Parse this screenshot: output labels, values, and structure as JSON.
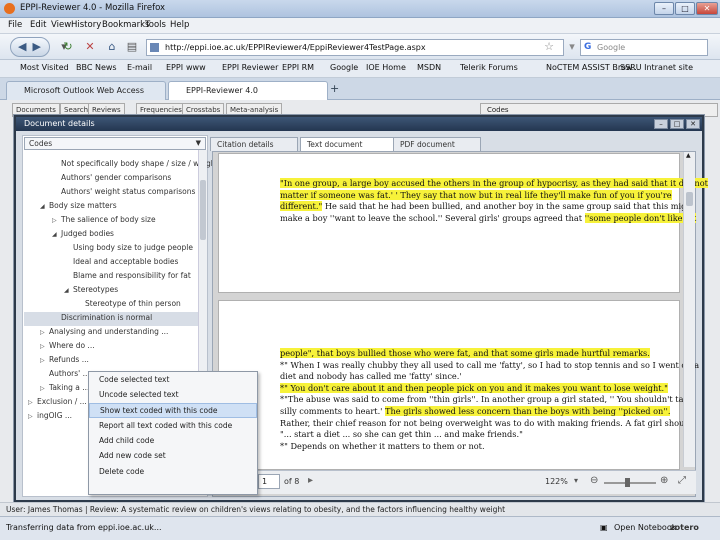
{
  "window": {
    "title": "EPPI-Reviewer 4.0 - Mozilla Firefox"
  },
  "menu": [
    "File",
    "Edit",
    "View",
    "History",
    "Bookmarks",
    "Tools",
    "Help"
  ],
  "nav": {
    "url": "http://eppi.ioe.ac.uk/EPPIReviewer4/EppiReviewer4TestPage.aspx",
    "search_placeholder": "Google"
  },
  "bookmarks": [
    "Most Visited",
    "BBC News",
    "E-mail",
    "EPPI",
    "www",
    "EPPI Reviewer",
    "EPPI RM",
    "Google",
    "IOE Home",
    "MSDN",
    "Telerik Forums",
    "NoCTEM ASSIST Brow...",
    "SSRU Intranet site"
  ],
  "browser_tabs": [
    "Microsoft Outlook Web Access",
    "EPPI-Reviewer 4.0"
  ],
  "app_tabs": [
    "Documents",
    "Search",
    "Reviews",
    "Frequencies",
    "Crosstabs",
    "Meta-analysis"
  ],
  "right_header": "Codes",
  "dialog": {
    "title": "Document details"
  },
  "code_select": "Codes",
  "tree": [
    {
      "label": "Not specifically body shape / size / weight",
      "indent": 2,
      "toggle": ""
    },
    {
      "label": "Authors' gender comparisons",
      "indent": 2,
      "toggle": ""
    },
    {
      "label": "Authors' weight status comparisons",
      "indent": 2,
      "toggle": ""
    },
    {
      "label": "Body size matters",
      "indent": 1,
      "toggle": "◢"
    },
    {
      "label": "The salience of body size",
      "indent": 2,
      "toggle": "▷"
    },
    {
      "label": "Judged bodies",
      "indent": 2,
      "toggle": "◢"
    },
    {
      "label": "Using body size to judge people",
      "indent": 3,
      "toggle": ""
    },
    {
      "label": "Ideal and acceptable bodies",
      "indent": 3,
      "toggle": ""
    },
    {
      "label": "Blame and responsibility for fat",
      "indent": 3,
      "toggle": ""
    },
    {
      "label": "Stereotypes",
      "indent": 3,
      "toggle": "◢"
    },
    {
      "label": "Stereotype of thin person",
      "indent": 4,
      "toggle": ""
    },
    {
      "label": "Discrimination is normal",
      "indent": 2,
      "toggle": "",
      "selected": true
    },
    {
      "label": "Analysing and understanding ...",
      "indent": 1,
      "toggle": "▷"
    },
    {
      "label": "Where do ...",
      "indent": 1,
      "toggle": "▷"
    },
    {
      "label": "Refunds ...",
      "indent": 1,
      "toggle": "▷"
    },
    {
      "label": "Authors' ...",
      "indent": 1,
      "toggle": ""
    },
    {
      "label": "Taking a ...",
      "indent": 1,
      "toggle": "▷"
    },
    {
      "label": "Exclusion / ...",
      "indent": 0,
      "toggle": "▷"
    },
    {
      "label": "ingOIG ...",
      "indent": 0,
      "toggle": "▷"
    }
  ],
  "doc_tabs": [
    "Citation details",
    "Text document",
    "PDF document"
  ],
  "page1": [
    [
      {
        "t": "\"In one group, a large boy accused the others in the group of hypocrisy, as they had said that it did not",
        "h": true
      }
    ],
    [
      {
        "t": "matter if someone was fat.' ' They say that now but in real life they'll make fun of you if you're",
        "h": true
      }
    ],
    [
      {
        "t": "different.\"",
        "h": true
      },
      {
        "t": " He said that he had been bullied, and another boy in the same group said that this might",
        "h": false
      }
    ],
    [
      {
        "t": "make a boy ''want to leave the school.'' Several girls' groups agreed that ",
        "h": false
      },
      {
        "t": "''some people don't like fat",
        "h": true
      }
    ]
  ],
  "page2": [
    [
      {
        "t": "people\", that boys bullied those who were fat, and that some girls made hurtful remarks.",
        "h": true
      }
    ],
    [
      {
        "t": "*\" When I was really chubby they all used to call me 'fatty', so I had to stop tennis and so I went on a",
        "h": false
      }
    ],
    [
      {
        "t": "diet and nobody has called me 'fatty' since.'",
        "h": false
      }
    ],
    [
      {
        "t": "*\" You don't care about it and then people pick on you and it makes you want to lose weight.\"",
        "h": true
      }
    ],
    [
      {
        "t": "*\"The abuse was said to come from ''thin girls''. In another group a girl stated, '' You shouldn't take",
        "h": false
      }
    ],
    [
      {
        "t": "silly comments to heart.' ",
        "h": false
      },
      {
        "t": "The girls showed less concern than the boys with being ''picked on''.",
        "h": true
      }
    ],
    [
      {
        "t": "Rather, their chief reason for not being overweight was to do with making friends. A fat girl should:",
        "h": false
      }
    ],
    [
      {
        "t": "\"... start a diet ... so she can get thin ... and make friends.\"",
        "h": false
      }
    ],
    [
      {
        "t": "*\" Depends on whether it matters to them or not.",
        "h": false
      }
    ]
  ],
  "pdf": {
    "page": "1",
    "of": "of 8",
    "zoom": "122%"
  },
  "context_menu": [
    "Code selected text",
    "Uncode selected text",
    "Show text coded with this code",
    "Report all text coded with this code",
    "Add child code",
    "Add new code set",
    "Delete code"
  ],
  "context_hover_index": 2,
  "app_status": "User: James Thomas | Review: A systematic review on children's views relating to obesity, and the factors influencing healthy weight",
  "ff_status": "Transferring data from eppi.ioe.ac.uk...",
  "ff_right": [
    "Open Notebook",
    "zotero"
  ]
}
